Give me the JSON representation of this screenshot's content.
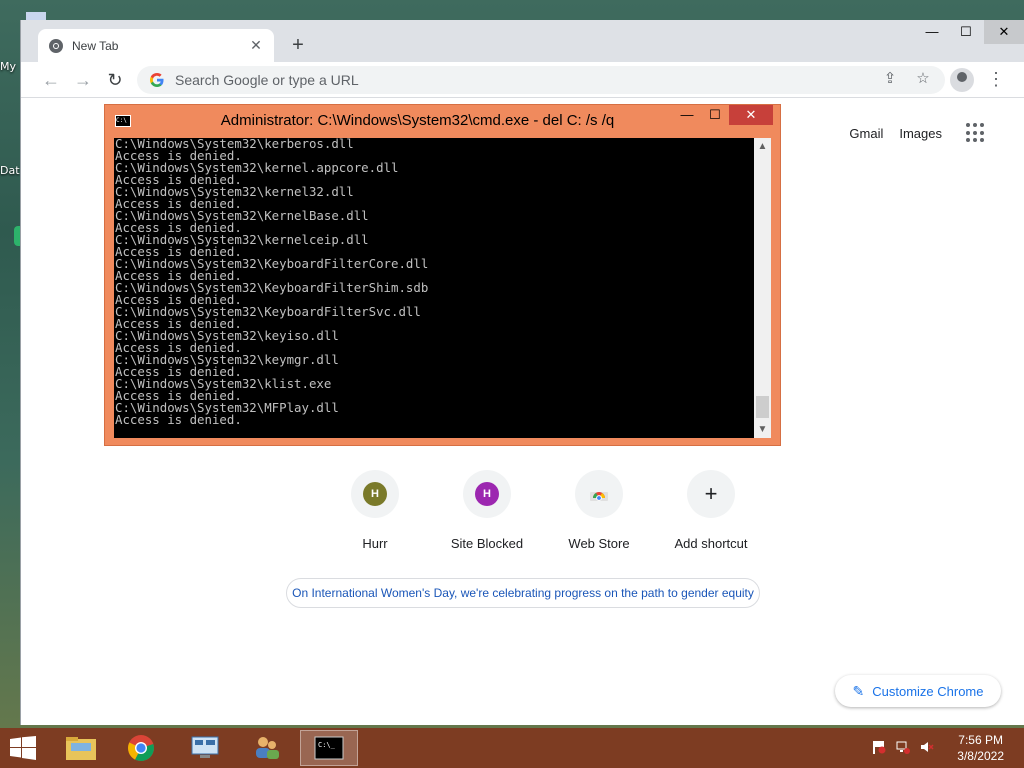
{
  "desktop": {
    "icon_label_1": "My",
    "icon_label_2": "Dat"
  },
  "browser": {
    "tab_title": "New Tab",
    "omnibox_placeholder": "Search Google or type a URL",
    "top_links": {
      "gmail": "Gmail",
      "images": "Images"
    },
    "shortcuts": [
      {
        "label": "Hurr",
        "letter": "H",
        "color": "#7a7a2a"
      },
      {
        "label": "Site Blocked",
        "letter": "H",
        "color": "#9c27b0"
      },
      {
        "label": "Web Store",
        "icon": "web-store-icon"
      },
      {
        "label": "Add shortcut",
        "icon": "plus-icon"
      }
    ],
    "promo_text": "On International Women's Day, we're celebrating progress on the path to gender equity",
    "customize_label": "Customize Chrome"
  },
  "cmd": {
    "title": "Administrator: C:\\Windows\\System32\\cmd.exe - del  C: /s /q",
    "output": [
      "C:\\Windows\\System32\\kerberos.dll",
      "Access is denied.",
      "C:\\Windows\\System32\\kernel.appcore.dll",
      "Access is denied.",
      "C:\\Windows\\System32\\kernel32.dll",
      "Access is denied.",
      "C:\\Windows\\System32\\KernelBase.dll",
      "Access is denied.",
      "C:\\Windows\\System32\\kernelceip.dll",
      "Access is denied.",
      "C:\\Windows\\System32\\KeyboardFilterCore.dll",
      "Access is denied.",
      "C:\\Windows\\System32\\KeyboardFilterShim.sdb",
      "Access is denied.",
      "C:\\Windows\\System32\\KeyboardFilterSvc.dll",
      "Access is denied.",
      "C:\\Windows\\System32\\keyiso.dll",
      "Access is denied.",
      "C:\\Windows\\System32\\keymgr.dll",
      "Access is denied.",
      "C:\\Windows\\System32\\klist.exe",
      "Access is denied.",
      "C:\\Windows\\System32\\MFPlay.dll",
      "Access is denied."
    ]
  },
  "taskbar": {
    "time": "7:56 PM",
    "date": "3/8/2022",
    "accent": "#7d3c22"
  }
}
